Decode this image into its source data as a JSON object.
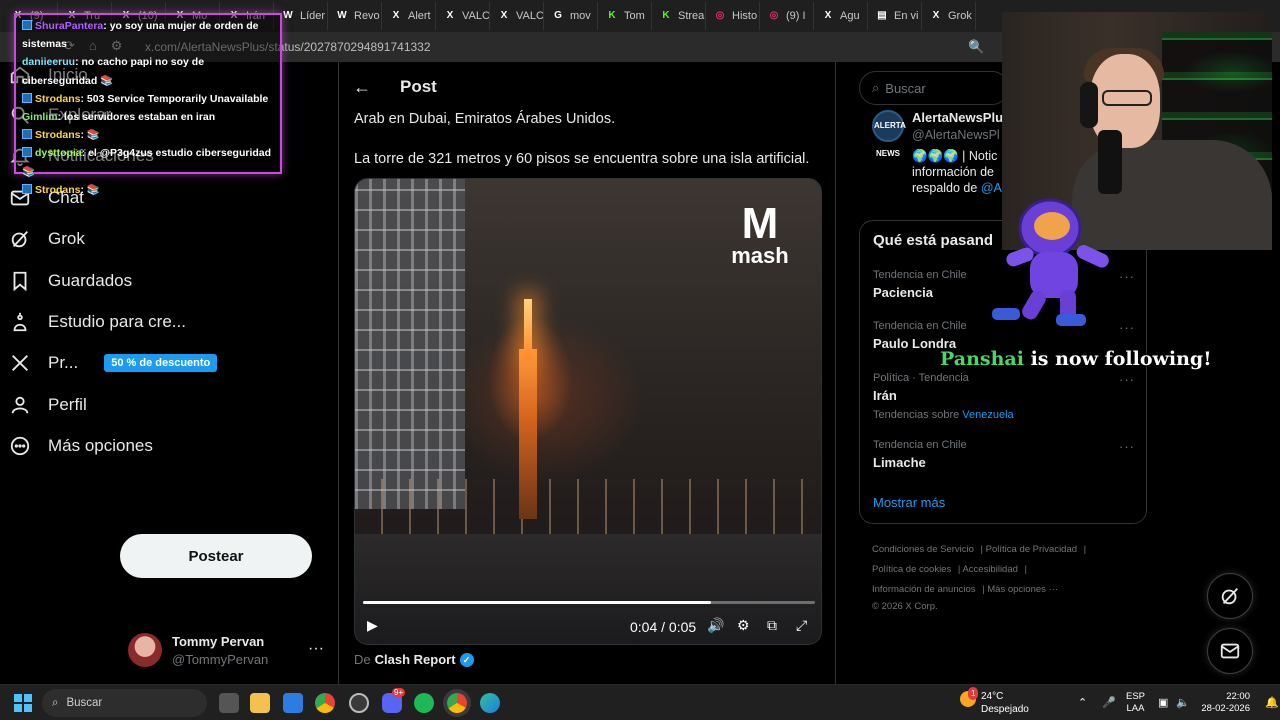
{
  "browser": {
    "tabs": [
      {
        "label": "(9)",
        "icon": "x-logo-icon",
        "color": "#ffffff"
      },
      {
        "label": "Tru",
        "icon": "x-logo-icon",
        "color": "#ffffff"
      },
      {
        "label": "(10)",
        "icon": "x-logo-icon",
        "color": "#ffffff"
      },
      {
        "label": "Mo",
        "icon": "x-logo-icon",
        "color": "#ffffff"
      },
      {
        "label": "Irán",
        "icon": "x-logo-icon",
        "color": "#ffffff"
      },
      {
        "label": "Líder",
        "icon": "wikipedia-icon",
        "color": "#ffffff"
      },
      {
        "label": "Revo",
        "icon": "wikipedia-icon",
        "color": "#ffffff"
      },
      {
        "label": "Alert",
        "icon": "x-logo-icon",
        "color": "#ffffff"
      },
      {
        "label": "VALC",
        "icon": "x-logo-icon",
        "color": "#ffffff"
      },
      {
        "label": "VALC",
        "icon": "x-logo-icon",
        "color": "#ffffff"
      },
      {
        "label": "mov",
        "icon": "google-icon",
        "color": "#ffffff"
      },
      {
        "label": "Tom",
        "icon": "kick-icon",
        "color": "#53fc18"
      },
      {
        "label": "Strea",
        "icon": "kick-icon",
        "color": "#53fc18"
      },
      {
        "label": "Histo",
        "icon": "instagram-icon",
        "color": "#e1306c"
      },
      {
        "label": "(9) I",
        "icon": "instagram-icon",
        "color": "#e1306c"
      },
      {
        "label": "Agu",
        "icon": "x-logo-icon",
        "color": "#ffffff"
      },
      {
        "label": "En vi",
        "icon": "live-icon",
        "color": "#ffffff"
      },
      {
        "label": "Grok",
        "icon": "x-logo-icon",
        "color": "#ffffff"
      }
    ],
    "url": "x.com/AlertaNewsPlus/status/2027870294891741332"
  },
  "nav": {
    "items": [
      {
        "label": "Inicio",
        "icon": "home-icon"
      },
      {
        "label": "Explorar",
        "icon": "search-icon"
      },
      {
        "label": "Notificaciones",
        "icon": "bell-icon"
      },
      {
        "label": "Chat",
        "icon": "mail-icon"
      },
      {
        "label": "Grok",
        "icon": "grok-icon"
      },
      {
        "label": "Guardados",
        "icon": "bookmark-icon"
      },
      {
        "label": "Estudio para cre...",
        "icon": "creator-studio-icon"
      },
      {
        "label": "Pr...",
        "icon": "x-logo-icon",
        "badge": "50 % de descuento"
      },
      {
        "label": "Perfil",
        "icon": "profile-icon"
      },
      {
        "label": "Más opciones",
        "icon": "more-circle-icon"
      }
    ],
    "post_button": "Postear",
    "user": {
      "name": "Tommy Pervan",
      "handle": "@TommyPervan"
    }
  },
  "main": {
    "title": "Post",
    "text_lines": [
      "Arab en Dubai, Emiratos Árabes Unidos.",
      "La torre de 321 metros y 60 pisos se encuentra sobre una isla artificial."
    ],
    "video": {
      "watermark_logo": "mash",
      "time": "0:04 / 0:05",
      "progress": 0.77
    },
    "source_prefix": "De",
    "source_name": "Clash Report"
  },
  "right": {
    "search_placeholder": "Buscar",
    "account": {
      "name": "AlertaNewsPlus",
      "handle": "@AlertaNewsPl",
      "desc_line1": "🌍🌍🌍 | Notic",
      "desc_line2": "información de",
      "desc_line3_prefix": "respaldo de",
      "desc_line3_link": "@A",
      "avatar_text": "ALERTA NEWS"
    },
    "trends_title": "Qué está pasand",
    "trends": [
      {
        "meta": "Tendencia en Chile",
        "name": "Paciencia",
        "sub_prefix": "",
        "sub_link": ""
      },
      {
        "meta": "Tendencia en Chile",
        "name": "Paulo Londra",
        "sub_prefix": "",
        "sub_link": ""
      },
      {
        "meta": "Política · Tendencia",
        "name": "Irán",
        "sub_prefix": "Tendencias sobre",
        "sub_link": "Venezuela"
      },
      {
        "meta": "Tendencia en Chile",
        "name": "Limache",
        "sub_prefix": "",
        "sub_link": ""
      }
    ],
    "show_more": "Mostrar más",
    "footer": {
      "l1": "Condiciones de Servicio",
      "l2": "Política de Privacidad",
      "l3": "Política de cookies",
      "l4": "Accesibilidad",
      "l5": "Información de anuncios",
      "l6": "Más opciones ···",
      "copyright": "© 2026 X Corp."
    }
  },
  "chat": [
    {
      "user": "ShuraPantera",
      "msg": ": yo soy una mujer de orden de sistemas",
      "cls": "u-shura",
      "badge": true
    },
    {
      "user": "daniieeruu",
      "msg": ": no cacho papi no soy de ciberseguridad 📚",
      "cls": "u-dani",
      "badge": false
    },
    {
      "user": "Strodans",
      "msg": ": 503 Service Temporarily Unavailable",
      "cls": "u-stro",
      "badge": true
    },
    {
      "user": "Gimlim",
      "msg": ": los servidores estaban en iran",
      "cls": "u-gim",
      "badge": false
    },
    {
      "user": "Strodans",
      "msg": ": 📚",
      "cls": "u-stro",
      "badge": true
    },
    {
      "user": "dysttopia",
      "msg": ": el @P3g4zus estudio ciberseguridad 📚",
      "cls": "u-dyst",
      "badge": true
    },
    {
      "user": "Strodans",
      "msg": ": 📚",
      "cls": "u-stro",
      "badge": true
    }
  ],
  "follow_alert": {
    "name": "Panshai",
    "text": "is now following!"
  },
  "taskbar": {
    "search": "Buscar",
    "weather_temp": "24°C",
    "weather_desc": "Despejado",
    "weather_badge": "1",
    "lang1": "ESP",
    "lang2": "LAA",
    "time": "22:00",
    "date": "28-02-2026",
    "discord_badge": "9+"
  },
  "colors": {
    "accent": "#1d9bf0",
    "chat_border": "#c84bd9",
    "kick_green": "#53fc18"
  }
}
